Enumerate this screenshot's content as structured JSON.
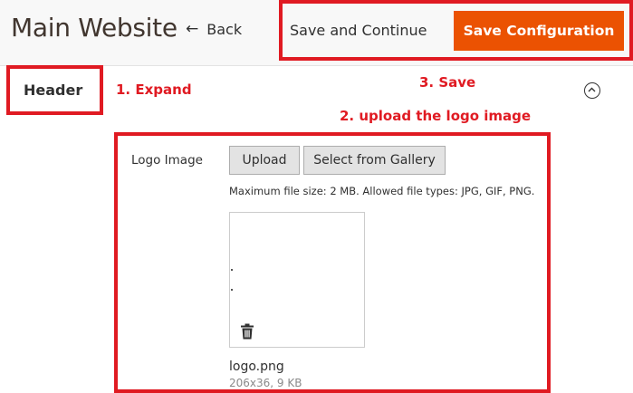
{
  "header": {
    "title": "Main Website",
    "back_label": "Back",
    "save_continue_label": "Save and Continue",
    "save_config_label": "Save Configuration"
  },
  "section": {
    "title": "Header"
  },
  "annotations": {
    "step1": "1. Expand",
    "step2": "2. upload the logo image",
    "step3": "3. Save"
  },
  "logo_field": {
    "label": "Logo Image",
    "upload_label": "Upload",
    "gallery_label": "Select from Gallery",
    "note": "Maximum file size: 2 MB. Allowed file types: JPG, GIF, PNG.",
    "file_name": "logo.png",
    "file_meta": "206x36, 9 KB"
  },
  "colors": {
    "accent": "#eb5202",
    "annotation": "#e01a22",
    "button_bg": "#e3e3e3"
  },
  "icons": [
    "back-arrow-icon",
    "collapse-chevron-icon",
    "trash-icon"
  ]
}
